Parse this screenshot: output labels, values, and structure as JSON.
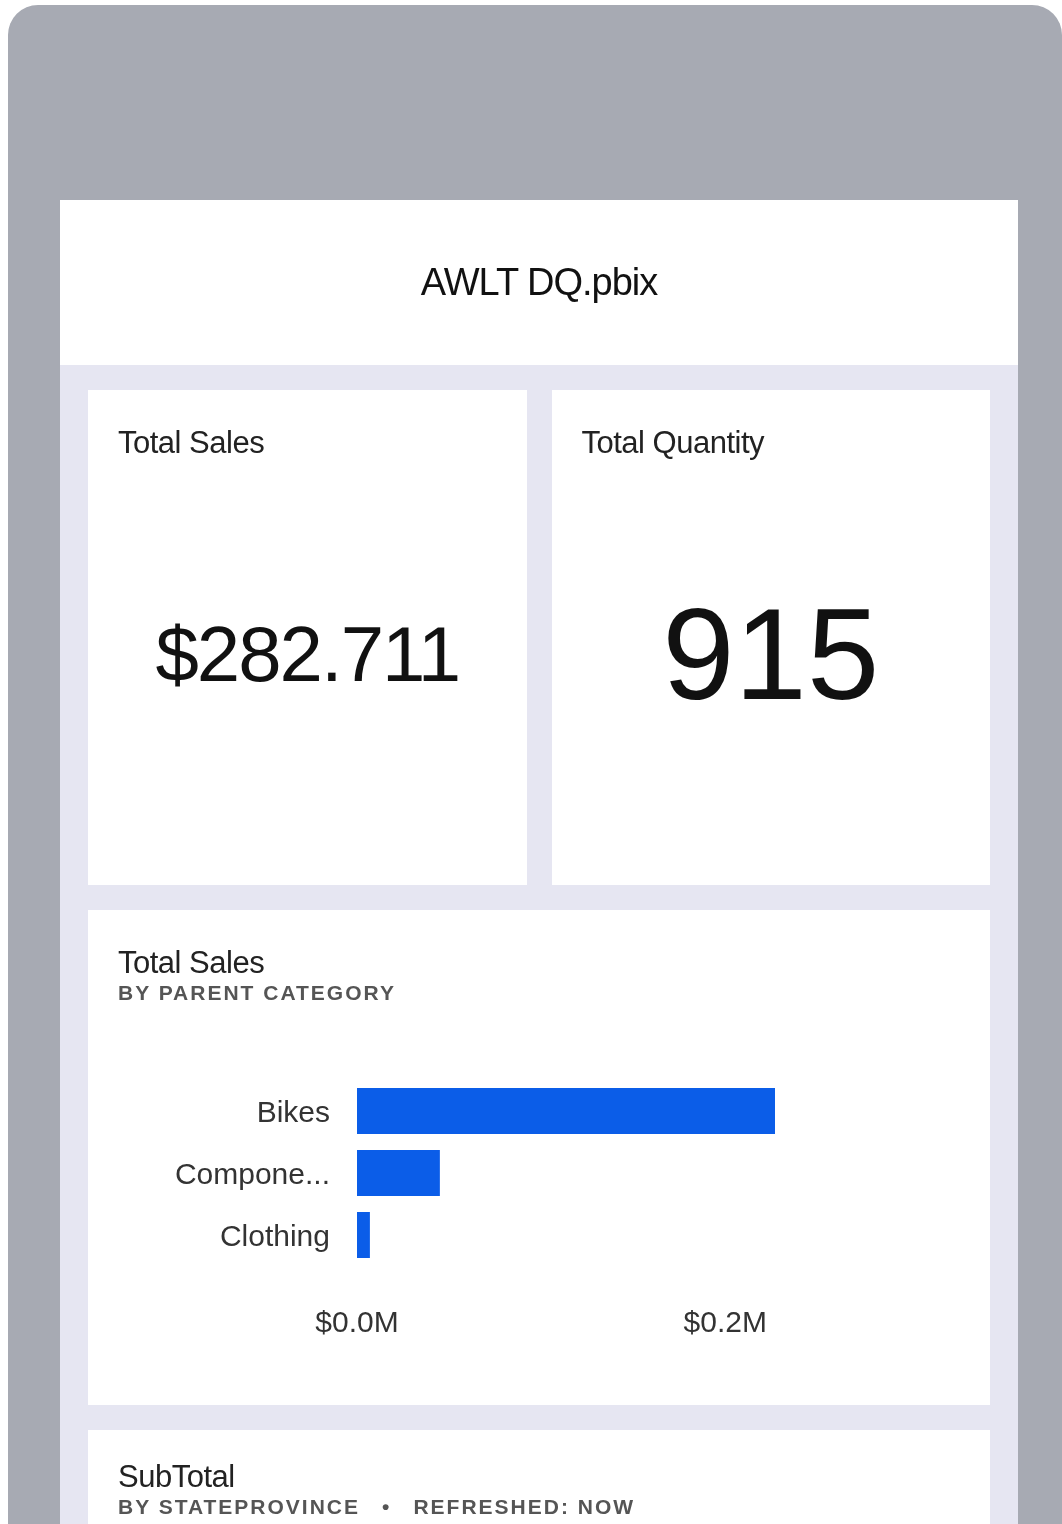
{
  "report": {
    "title": "AWLT DQ.pbix"
  },
  "tiles": [
    {
      "kind": "card",
      "title": "Total Sales",
      "value": "$282.711"
    },
    {
      "kind": "card",
      "title": "Total Quantity",
      "value": "915"
    },
    {
      "kind": "chart",
      "title": "Total Sales",
      "subtitle": "BY PARENT CATEGORY",
      "chart_data": {
        "type": "bar",
        "orientation": "horizontal",
        "categories": [
          "Bikes",
          "Compone...",
          "Clothing"
        ],
        "series": [
          {
            "color": "#0b5de8",
            "values": [
              0.227,
              0.045,
              0.007
            ]
          }
        ],
        "xlim": [
          0,
          0.227
        ],
        "xticks": [
          {
            "value": 0,
            "label": "$0.0M"
          },
          {
            "value": 0.2,
            "label": "$0.2M"
          }
        ]
      }
    },
    {
      "kind": "visual",
      "title": "SubTotal",
      "subtitle": "BY STATEPROVINCE",
      "separator": "•",
      "status": "REFRESHED: NOW"
    }
  ]
}
